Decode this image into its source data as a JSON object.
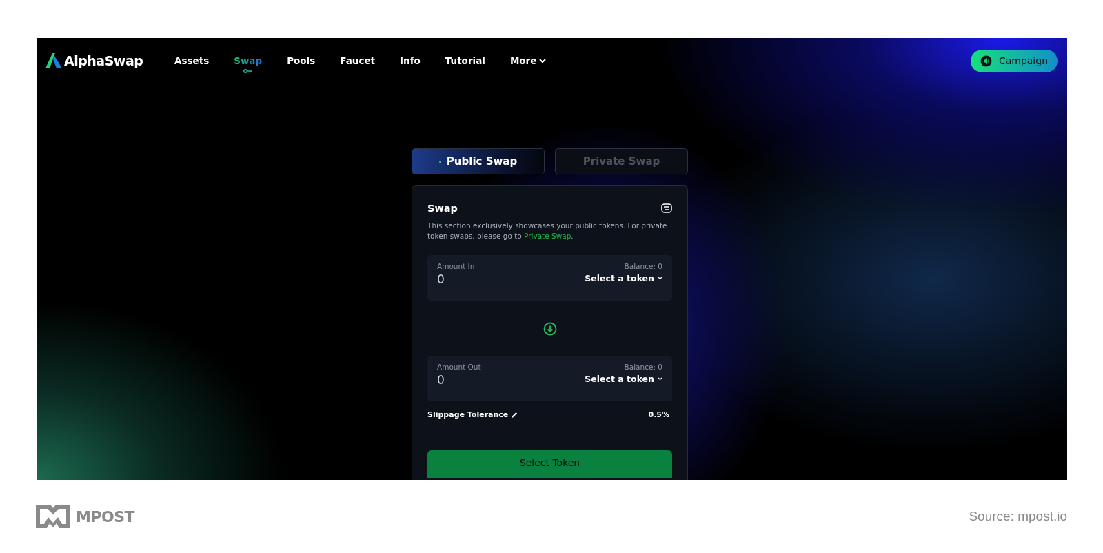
{
  "brand": {
    "name": "AlphaSwap"
  },
  "nav": [
    {
      "label": "Assets",
      "selected": false,
      "kind": "link"
    },
    {
      "label": "Swap",
      "selected": true,
      "kind": "link"
    },
    {
      "label": "Pools",
      "selected": false,
      "kind": "link"
    },
    {
      "label": "Faucet",
      "selected": false,
      "kind": "link"
    },
    {
      "label": "Info",
      "selected": false,
      "kind": "link"
    },
    {
      "label": "Tutorial",
      "selected": false,
      "kind": "link"
    },
    {
      "label": "More",
      "selected": false,
      "kind": "dropdown"
    }
  ],
  "campaign_button": {
    "label": "Campaign"
  },
  "swap_tabs": [
    {
      "label": "Public Swap",
      "selected": true
    },
    {
      "label": "Private Swap",
      "selected": false
    }
  ],
  "swap": {
    "title": "Swap",
    "description": "This section exclusively showcases your public tokens. For private token swaps, please go to ",
    "link": "Private Swap",
    "description_end": ".",
    "fields": [
      {
        "label": "Amount In",
        "balance": "Balance: 0",
        "value": "0",
        "token": "Select a token"
      },
      {
        "label": "Amount Out",
        "balance": "Balance: 0",
        "value": "0",
        "token": "Select a token"
      }
    ],
    "slippage": {
      "label": "Slippage Tolerance",
      "value": "0.5%"
    },
    "submit": "Select Token"
  },
  "footer": {
    "logo": "MPOST",
    "source": "Source: mpost.io"
  }
}
